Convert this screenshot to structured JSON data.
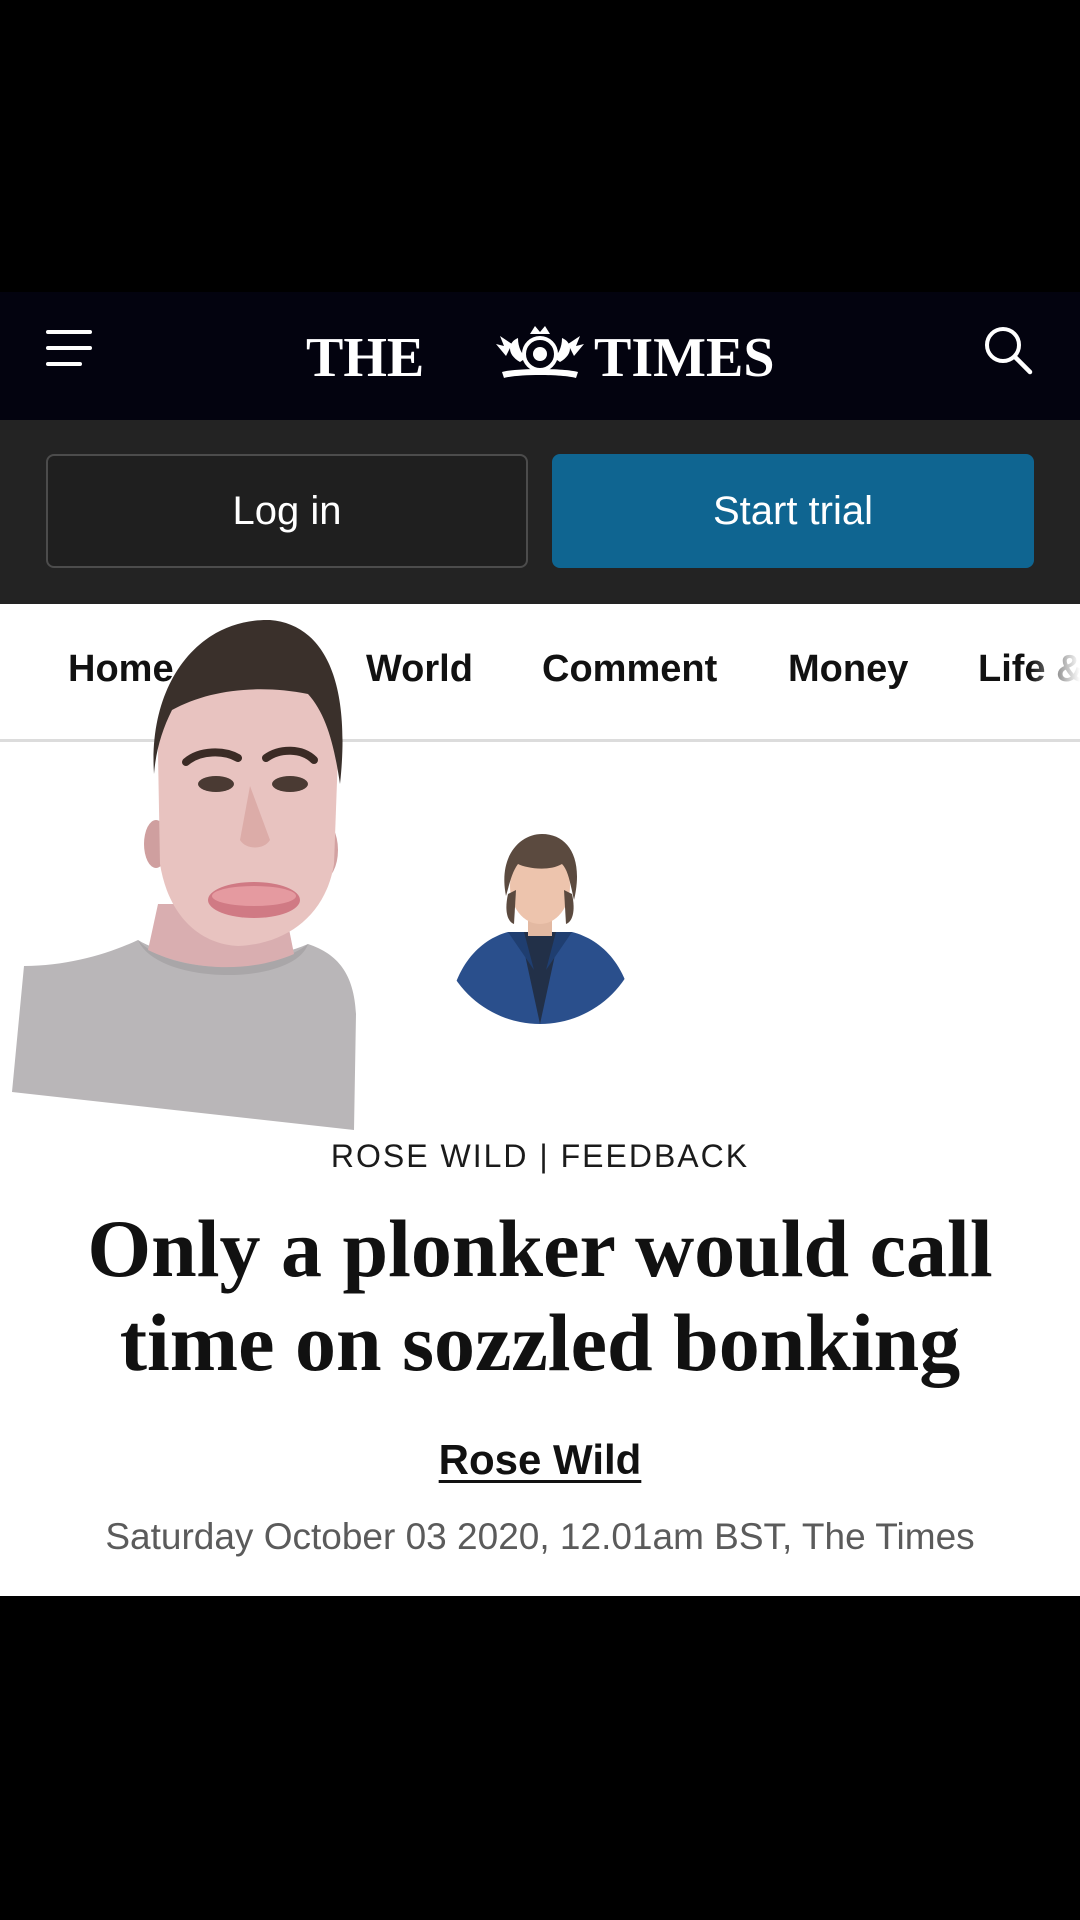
{
  "header": {
    "logo_left": "THE",
    "logo_right": "TIMES",
    "menu_icon": "hamburger-menu-icon",
    "search_icon": "search-icon"
  },
  "auth": {
    "login_label": "Log in",
    "trial_label": "Start trial"
  },
  "nav": {
    "items": [
      "Home",
      "World",
      "Comment",
      "Money",
      "Life &"
    ]
  },
  "article": {
    "kicker": "ROSE WILD | FEEDBACK",
    "headline": "Only a plonker would call time on sozzled bonking",
    "author": "Rose Wild",
    "dateline": "Saturday October 03 2020, 12.01am BST, The Times"
  },
  "colors": {
    "header_bg": "#03030f",
    "authbar_bg": "#232323",
    "trial_button": "#0f6591",
    "page_bg": "#ffffff"
  }
}
